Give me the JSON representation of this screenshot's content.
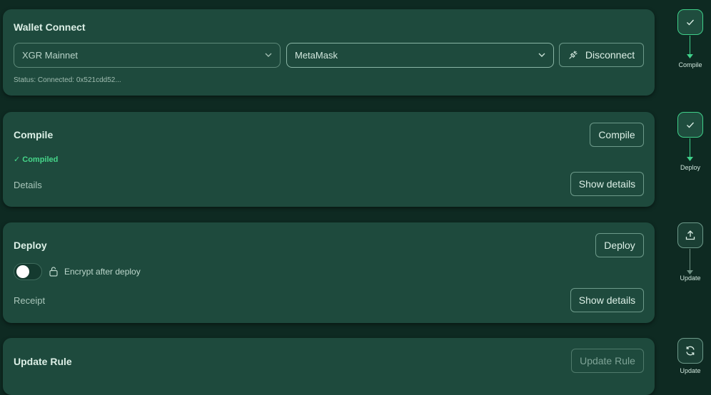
{
  "wallet": {
    "title": "Wallet Connect",
    "network": "XGR Mainnet",
    "provider": "MetaMask",
    "disconnect_label": "Disconnect",
    "status": "Status: Connected: 0x521cdd52..."
  },
  "compile": {
    "title": "Compile",
    "button": "Compile",
    "compiled": "✓ Compiled",
    "details_label": "Details",
    "details_button": "Show details"
  },
  "deploy": {
    "title": "Deploy",
    "button": "Deploy",
    "encrypt_label": "Encrypt after deploy",
    "encrypt_on": false,
    "receipt_label": "Receipt",
    "details_button": "Show details"
  },
  "update": {
    "title": "Update Rule",
    "button": "Update Rule"
  },
  "steps": [
    {
      "label": "Compile",
      "icon": "check-icon",
      "done": true
    },
    {
      "label": "Deploy",
      "icon": "check-icon",
      "done": true
    },
    {
      "label": "Update",
      "icon": "upload-icon",
      "done": false
    },
    {
      "label": "Update",
      "icon": "refresh-icon",
      "done": false
    }
  ],
  "colors": {
    "background": "#0e2a22",
    "card": "#1e4a3d",
    "accent": "#3fd08a",
    "success_text": "#46d68a"
  }
}
